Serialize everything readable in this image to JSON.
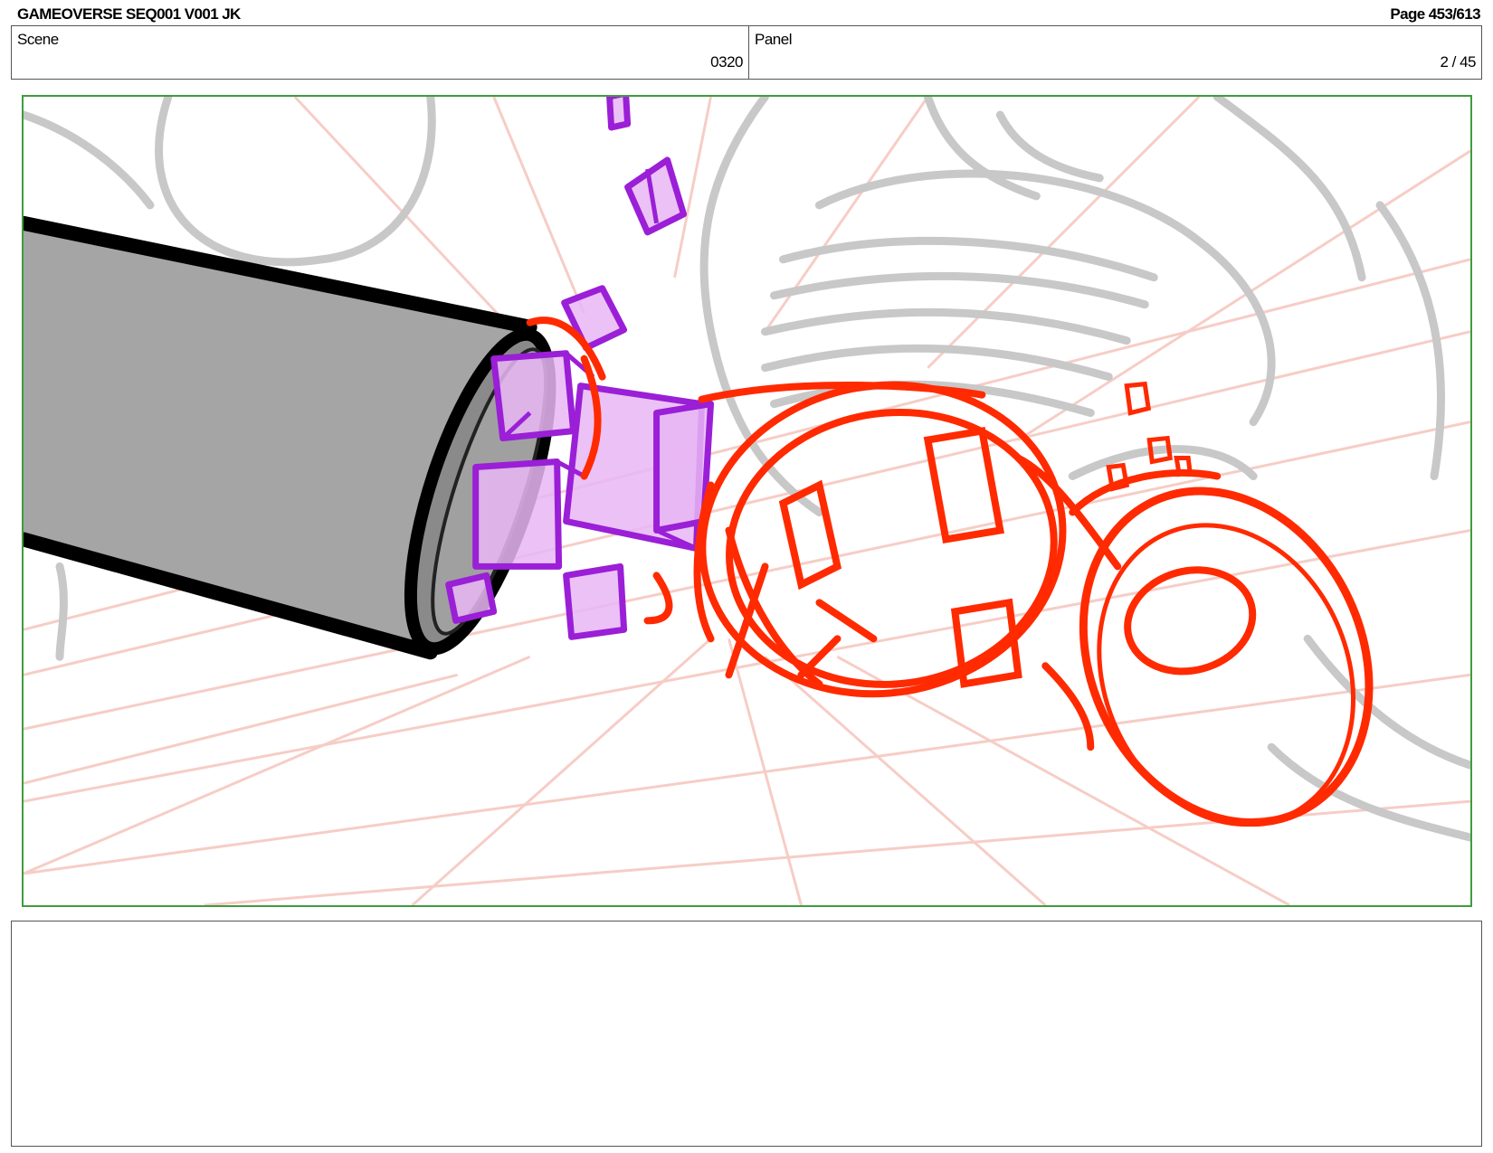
{
  "header": {
    "title": "GAMEOVERSE SEQ001 V001 JK",
    "page": "Page 453/613"
  },
  "info": {
    "scene_label": "Scene",
    "scene_value": "0320",
    "panel_label": "Panel",
    "panel_value": "2 / 45"
  },
  "artwork": {
    "colors": {
      "frame_border": "#3f9c3f",
      "grid": "#f6c8c0",
      "background_sketch": "#c8c8c8",
      "cylinder_fill": "#a5a5a5",
      "cylinder_outline": "#000000",
      "cubes": "#9a1fd6",
      "cubes_fill": "#e8b6f5",
      "character_sketch": "#ff2a00"
    }
  },
  "notes": {
    "text": ""
  }
}
